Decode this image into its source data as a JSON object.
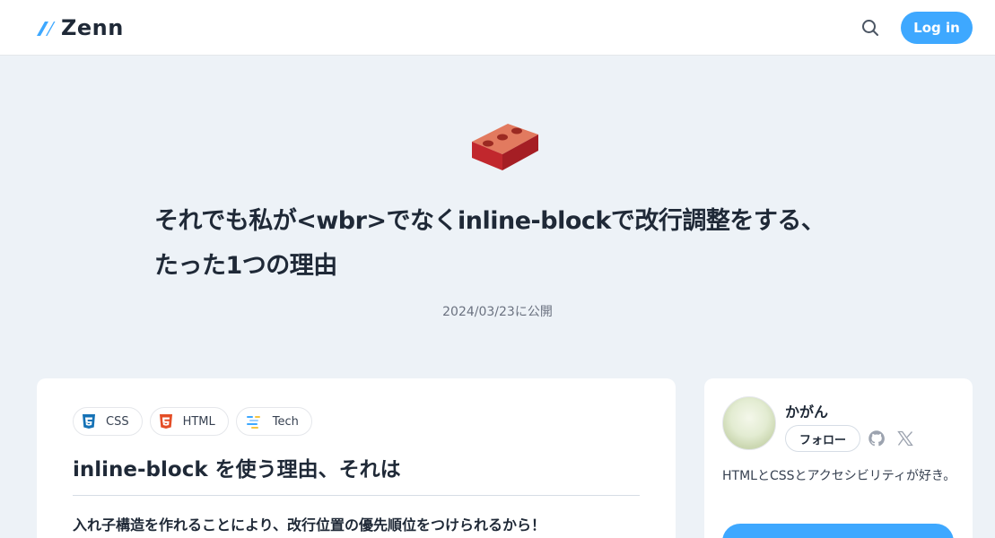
{
  "header": {
    "logo_text": "Zenn",
    "login_label": "Log in",
    "search_icon": "search-icon",
    "accent_color": "#3ea8ff"
  },
  "article": {
    "emoji": "brick",
    "title_line1": "それでも私が<wbr>でなくinline-blockで改行調整をする、",
    "title_line2": "たった1つの理由",
    "published": "2024/03/23に公開",
    "tags": [
      {
        "label": "CSS",
        "icon": "css3-icon"
      },
      {
        "label": "HTML",
        "icon": "html5-icon"
      },
      {
        "label": "Tech",
        "icon": "tech-icon"
      }
    ],
    "heading": "inline-block を使う理由、それは",
    "lead": "入れ子構造を作れることにより、改行位置の優先順位をつけられるから！"
  },
  "author": {
    "name": "かがん",
    "follow_label": "フォロー",
    "bio": "HTMLとCSSとアクセシビリティが好き。"
  }
}
